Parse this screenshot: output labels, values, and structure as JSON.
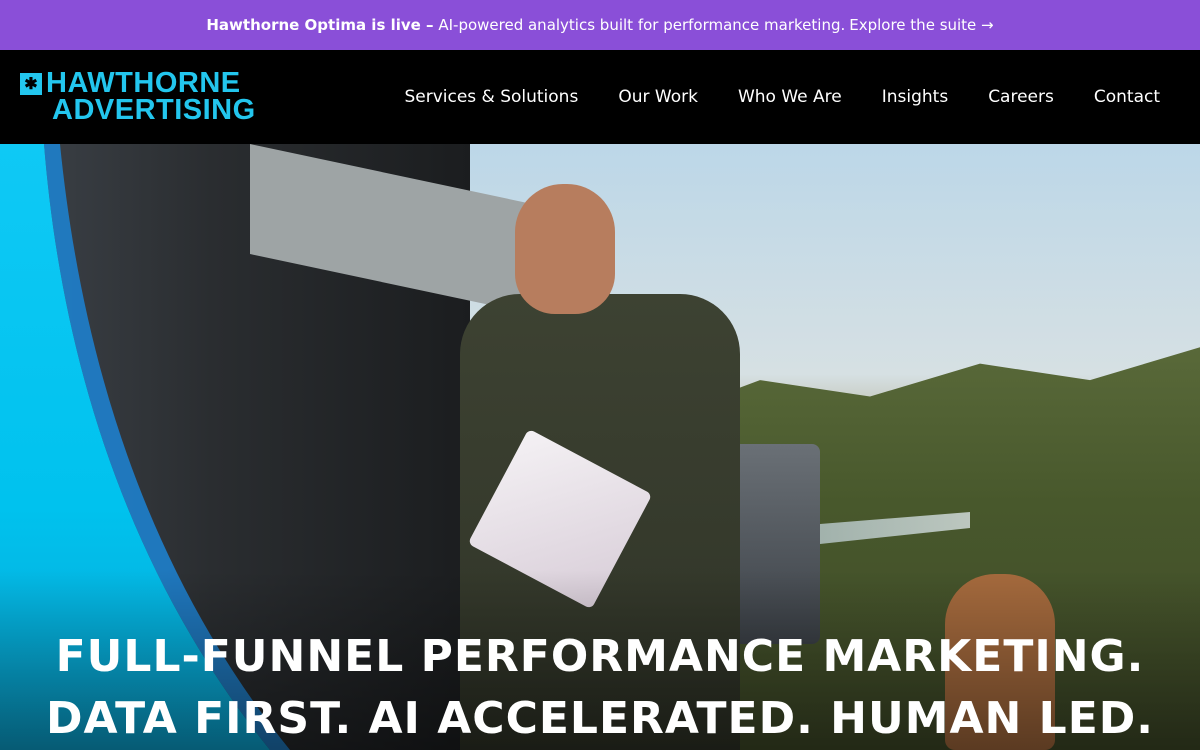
{
  "announcement": {
    "bold": "Hawthorne Optima is live –",
    "text": "AI-powered analytics built for performance marketing.",
    "cta": "Explore the suite →"
  },
  "brand": {
    "line1": "HAWTHORNE",
    "line2": "ADVERTISING",
    "mark": "✱"
  },
  "nav": {
    "services": "Services & Solutions",
    "work": "Our Work",
    "who": "Who We Are",
    "insights": "Insights",
    "careers": "Careers",
    "contact": "Contact"
  },
  "hero": {
    "line1": "FULL-FUNNEL PERFORMANCE MARKETING.",
    "line2": "DATA FIRST. AI ACCELERATED. HUMAN LED."
  },
  "colors": {
    "announce_bg": "#8a4fd8",
    "brand_blue": "#23c6ee",
    "header_bg": "#000000"
  }
}
